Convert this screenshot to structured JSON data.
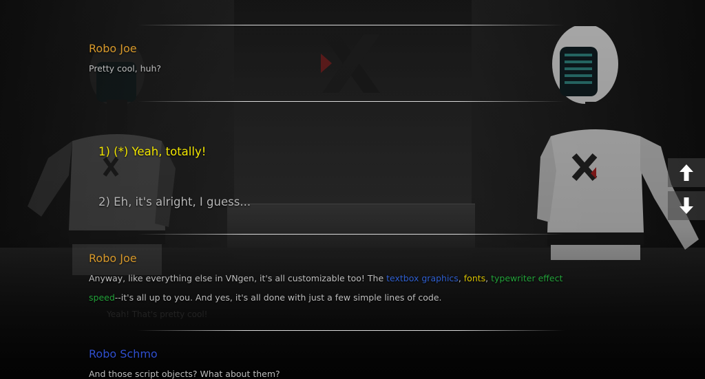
{
  "history": [
    {
      "speaker": "Robo Joe",
      "text": "Pretty cool, huh?"
    }
  ],
  "choices": [
    {
      "label": "1) (*) Yeah, totally!",
      "selected": true
    },
    {
      "label": "2) Eh, it's alright, I guess..."
    }
  ],
  "current": {
    "speaker": "Robo Joe",
    "text_before": "Anyway, like everything else in VNgen, it's all customizable too! The ",
    "highlight_1": "textbox graphics",
    "sep_1": ", ",
    "highlight_2": "fonts",
    "sep_2": ", ",
    "highlight_3": "typewriter effect",
    "highlight_4": "speed",
    "text_after": "--it's all up to you. And yes, it's all done with just a few simple lines of code."
  },
  "ghost_text": "Yeah! That's pretty cool!",
  "next": {
    "speaker": "Robo Schmo",
    "text": "And those script objects? What about them?"
  },
  "colors": {
    "speaker_joe": "#d99a2b",
    "speaker_schmo": "#2f4fd0",
    "choice_selected": "#f2e600",
    "highlight_blue": "#2f5fd0",
    "highlight_yellow": "#d8c200",
    "highlight_green": "#23a23a"
  },
  "icons": [
    "arrow-up-icon",
    "arrow-down-icon",
    "x-logo-icon"
  ]
}
